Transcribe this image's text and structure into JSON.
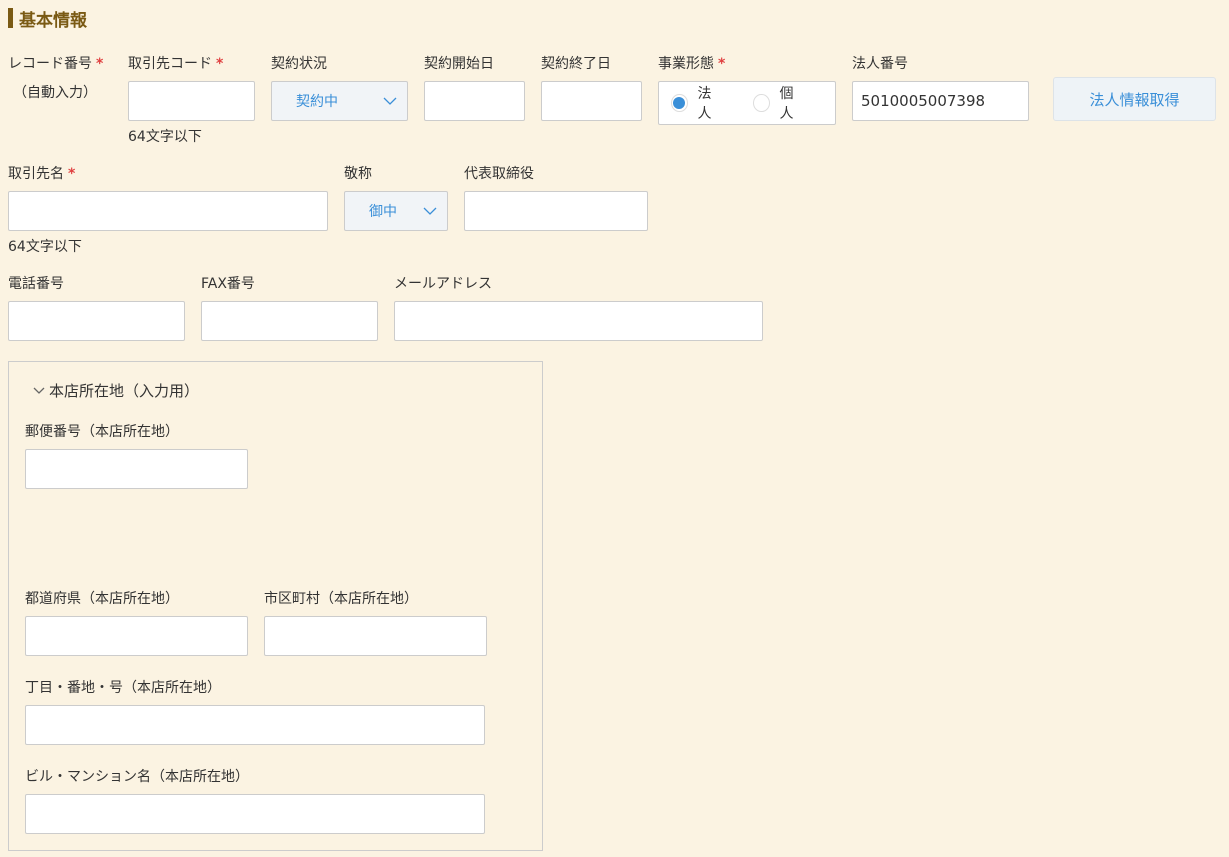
{
  "section": {
    "title": "基本情報"
  },
  "required_mark": "*",
  "fields": {
    "record_no": {
      "label": "レコード番号",
      "value": "（自動入力）"
    },
    "client_code": {
      "label": "取引先コード",
      "note": "64文字以下",
      "value": ""
    },
    "contract_status": {
      "label": "契約状況",
      "selected": "契約中"
    },
    "contract_start": {
      "label": "契約開始日",
      "value": ""
    },
    "contract_end": {
      "label": "契約終了日",
      "value": ""
    },
    "business_type": {
      "label": "事業形態",
      "options": [
        {
          "label": "法人",
          "checked": true
        },
        {
          "label": "個人",
          "checked": false
        }
      ]
    },
    "corp_number": {
      "label": "法人番号",
      "value": "5010005007398"
    },
    "fetch_button": {
      "label": "法人情報取得"
    },
    "client_name": {
      "label": "取引先名",
      "note": "64文字以下",
      "value": ""
    },
    "honorific": {
      "label": "敬称",
      "selected": "御中"
    },
    "representative": {
      "label": "代表取締役",
      "value": ""
    },
    "phone": {
      "label": "電話番号",
      "value": ""
    },
    "fax": {
      "label": "FAX番号",
      "value": ""
    },
    "email": {
      "label": "メールアドレス",
      "value": ""
    }
  },
  "address_panel": {
    "title": "本店所在地（入力用）",
    "postal": {
      "label": "郵便番号（本店所在地）",
      "value": ""
    },
    "prefecture": {
      "label": "都道府県（本店所在地）",
      "value": ""
    },
    "city": {
      "label": "市区町村（本店所在地）",
      "value": ""
    },
    "street": {
      "label": "丁目・番地・号（本店所在地）",
      "value": ""
    },
    "building": {
      "label": "ビル・マンション名（本店所在地）",
      "value": ""
    }
  },
  "colors": {
    "accent": "#3a8fd8",
    "title": "#7a5a14",
    "required": "#e04040",
    "background": "#fbf3e2"
  },
  "icons": {
    "dropdown": "chevron-down-icon",
    "panel_toggle": "chevron-down-icon"
  }
}
